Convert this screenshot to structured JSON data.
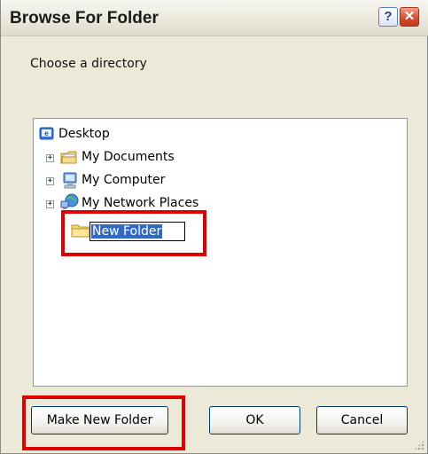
{
  "window": {
    "title": "Browse For Folder",
    "help_label": "?",
    "close_label": "✕"
  },
  "prompt": "Choose a directory",
  "tree": {
    "root": {
      "label": "Desktop",
      "icon": "desktop-icon"
    },
    "items": [
      {
        "label": "My Documents",
        "icon": "my-documents-icon",
        "expander": "+"
      },
      {
        "label": "My Computer",
        "icon": "my-computer-icon",
        "expander": "+"
      },
      {
        "label": "My Network Places",
        "icon": "network-places-icon",
        "expander": "+"
      }
    ],
    "new_item": {
      "value": "New Folder",
      "icon": "folder-icon"
    }
  },
  "buttons": {
    "make_new_folder": "Make New Folder",
    "ok": "OK",
    "cancel": "Cancel"
  },
  "colors": {
    "highlight": "#e00000",
    "selection": "#316ac5",
    "tree_border": "#7f9db9"
  }
}
